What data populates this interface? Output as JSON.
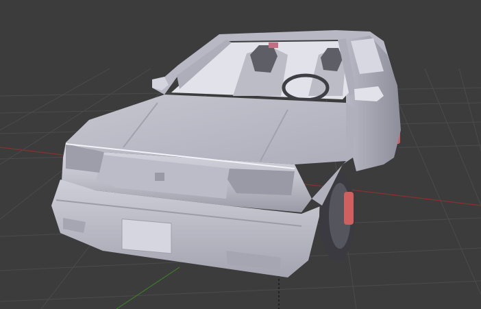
{
  "viewport": {
    "background": "#3c3c3c",
    "grid_color": "#4a4a4a",
    "x_axis_color": "#8a3030",
    "y_axis_color": "#3a7a2a"
  },
  "model": {
    "body_color": "#c8c8d2",
    "body_shadow": "#8c8c98",
    "glass_color": "#e4e4ec",
    "tire_color": "#3a3a40",
    "brake_color": "#d06060",
    "seat_color": "#5a5a62"
  }
}
